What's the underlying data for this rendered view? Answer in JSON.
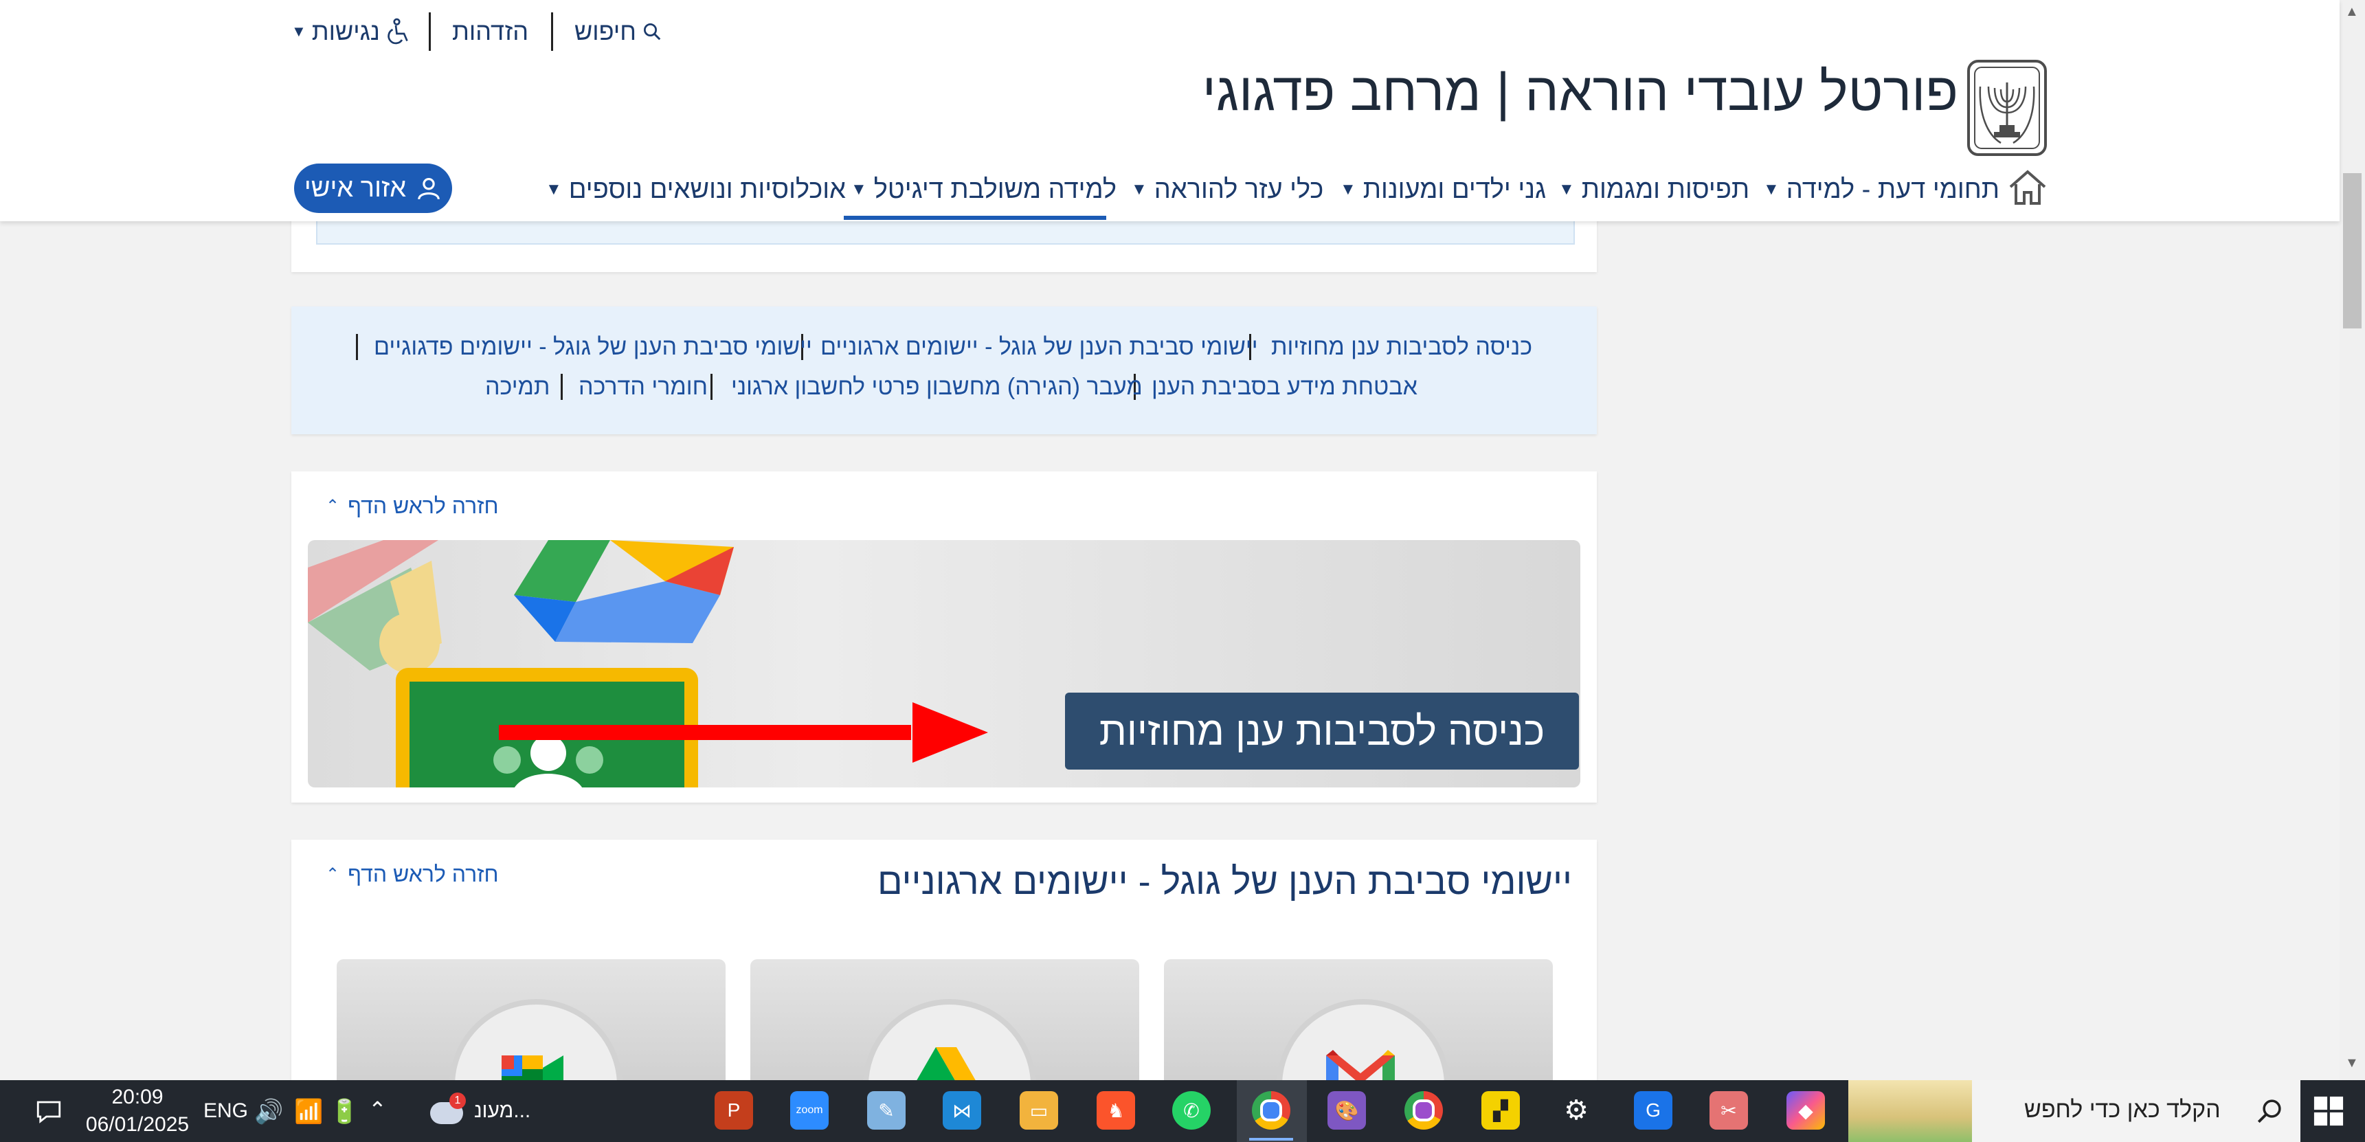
{
  "header": {
    "site_title": "פורטל עובדי הוראה | מרחב פדגוגי",
    "utility": {
      "search": "חיפוש",
      "login": "הזדהות",
      "accessibility": "נגישות"
    },
    "nav": {
      "home_icon": "home-icon",
      "items": [
        "תחומי דעת - למידה",
        "תפיסות ומגמות",
        "גני ילדים ומעונות",
        "כלי עזר להוראה",
        "למידה משולבת דיגיטל",
        "אוכלוסיות ונושאים נוספים"
      ],
      "active_index": 4
    },
    "personal_area": "אזור אישי"
  },
  "quick_links": {
    "row1": [
      "כניסה לסביבות ענן מחוזיות",
      "יישומי סביבת הענן של גוגל - יישומים ארגוניים",
      "יישומי סביבת הענן של גוגל - יישומים פדגוגיים"
    ],
    "row2": [
      "אבטחת מידע בסביבת הענן",
      "מעבר (הגירה) מחשבון פרטי לחשבון ארגוני",
      "חומרי הדרכה",
      "תמיכה"
    ]
  },
  "sections": {
    "back_to_top": "חזרה לראש הדף",
    "banner_label": "כניסה לסביבות ענן מחוזיות",
    "apps_heading": "יישומי סביבת הענן של גוגל - יישומים ארגוניים"
  },
  "taskbar": {
    "search_placeholder": "הקלד כאן כדי לחפש",
    "weather_label": "מעונ...",
    "weather_badge": "1",
    "language": "ENG",
    "time": "20:09",
    "date": "06/01/2025"
  },
  "colors": {
    "brand_blue": "#1c5bb5",
    "link_blue": "#1c4f9c",
    "banner_label_bg": "#2e4d6f",
    "arrow_red": "#ff0000"
  }
}
